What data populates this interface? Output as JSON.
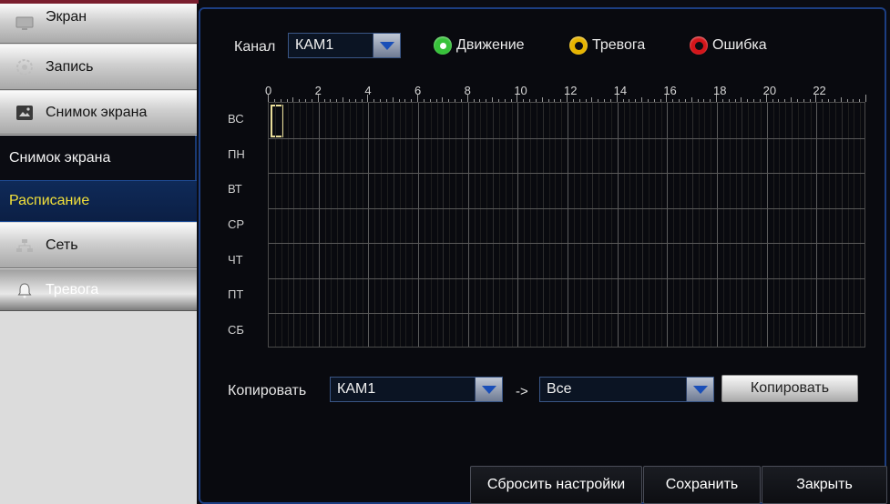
{
  "sidebar": {
    "items": [
      {
        "label": "Экран",
        "icon": "monitor-icon"
      },
      {
        "label": "Запись",
        "icon": "record-icon"
      },
      {
        "label": "Снимок экрана",
        "icon": "image-icon"
      },
      {
        "label": "Снимок экрана"
      },
      {
        "label": "Расписание"
      },
      {
        "label": "Сеть",
        "icon": "network-icon"
      },
      {
        "label": "Тревога",
        "icon": "bell-icon"
      }
    ]
  },
  "channel": {
    "label": "Канал",
    "value": "КАМ1"
  },
  "legend": [
    {
      "label": "Движение",
      "color": "#37c23a"
    },
    {
      "label": "Тревога",
      "color": "#e6b400"
    },
    {
      "label": "Ошибка",
      "color": "#d3151a"
    }
  ],
  "schedule": {
    "hours": [
      "0",
      "2",
      "4",
      "6",
      "8",
      "10",
      "12",
      "14",
      "16",
      "18",
      "20",
      "22"
    ],
    "days": [
      "ВС",
      "ПН",
      "ВТ",
      "СР",
      "ЧТ",
      "ПТ",
      "СБ"
    ]
  },
  "copy": {
    "label": "Копировать",
    "source": "КАМ1",
    "arrow": "->",
    "target": "Все",
    "button": "Копировать"
  },
  "footer": {
    "reset": "Сбросить настройки",
    "save": "Сохранить",
    "close": "Закрыть"
  },
  "colors": {
    "accent": "#f3e13a",
    "panel_border": "#1c3e82"
  }
}
